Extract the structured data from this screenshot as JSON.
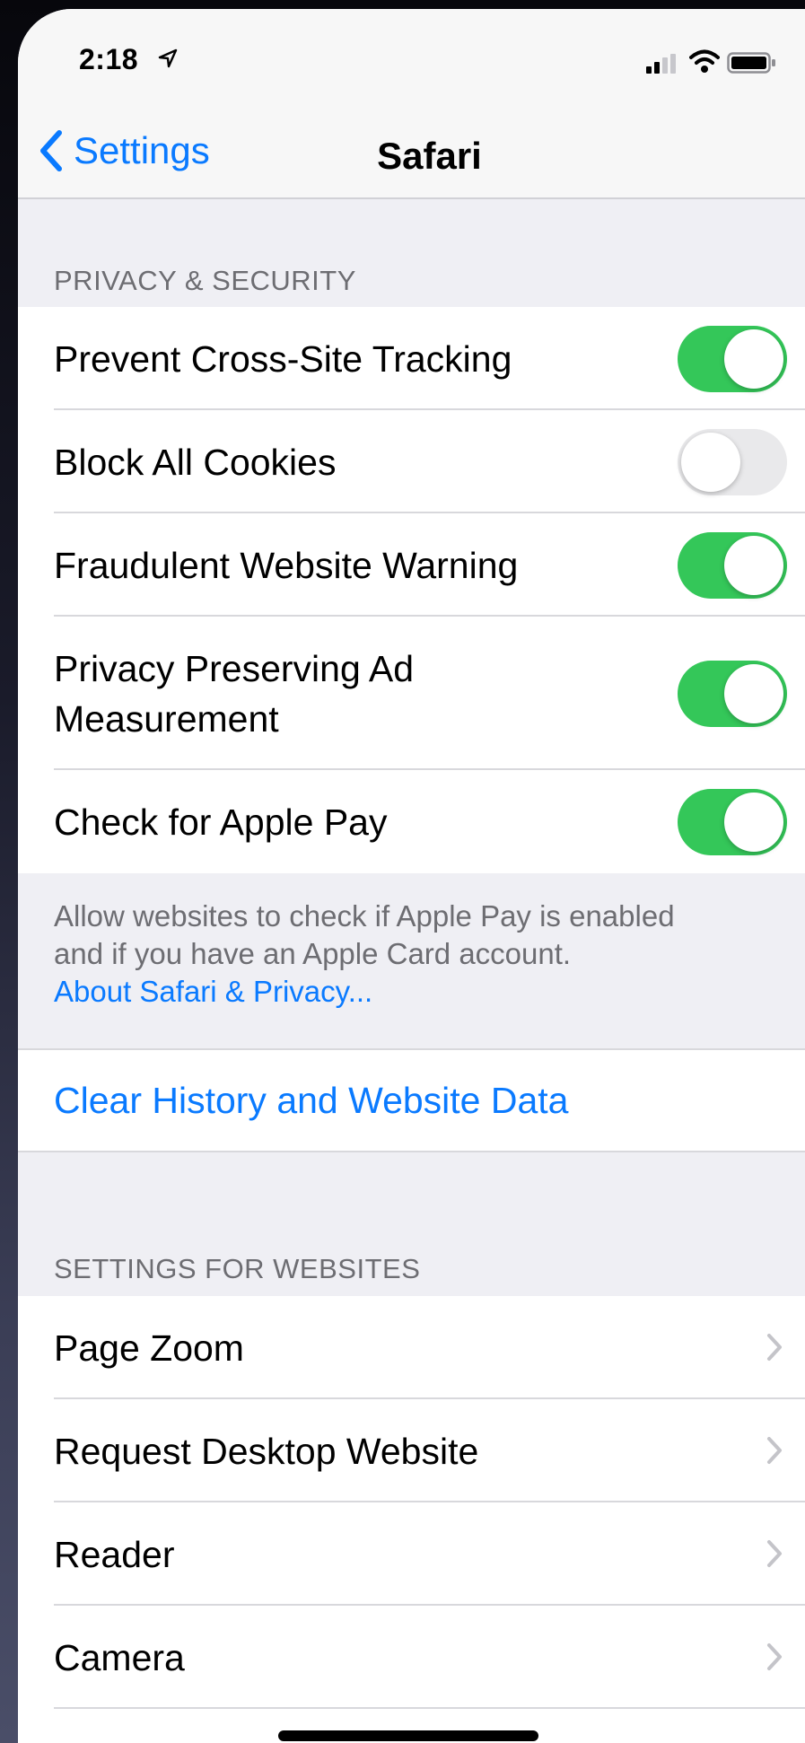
{
  "status_bar": {
    "time": "2:18"
  },
  "nav": {
    "back_label": "Settings",
    "title": "Safari"
  },
  "privacy": {
    "header": "PRIVACY & SECURITY",
    "rows": [
      {
        "label": "Prevent Cross-Site Tracking",
        "enabled": true
      },
      {
        "label": "Block All Cookies",
        "enabled": false
      },
      {
        "label": "Fraudulent Website Warning",
        "enabled": true
      },
      {
        "label_line1": "Privacy Preserving Ad",
        "label_line2": "Measurement",
        "enabled": true
      },
      {
        "label": "Check for Apple Pay",
        "enabled": true
      }
    ],
    "footer_line1": "Allow websites to check if Apple Pay is enabled",
    "footer_line2": "and if you have an Apple Card account.",
    "footer_link": "About Safari & Privacy..."
  },
  "clear": {
    "label": "Clear History and Website Data"
  },
  "websites": {
    "header": "SETTINGS FOR WEBSITES",
    "rows": [
      {
        "label": "Page Zoom"
      },
      {
        "label": "Request Desktop Website"
      },
      {
        "label": "Reader"
      },
      {
        "label": "Camera"
      }
    ]
  },
  "colors": {
    "accent": "#0a7aff",
    "toggle_on": "#34c759",
    "toggle_off": "#e9e9eb",
    "background": "#efeff4"
  }
}
